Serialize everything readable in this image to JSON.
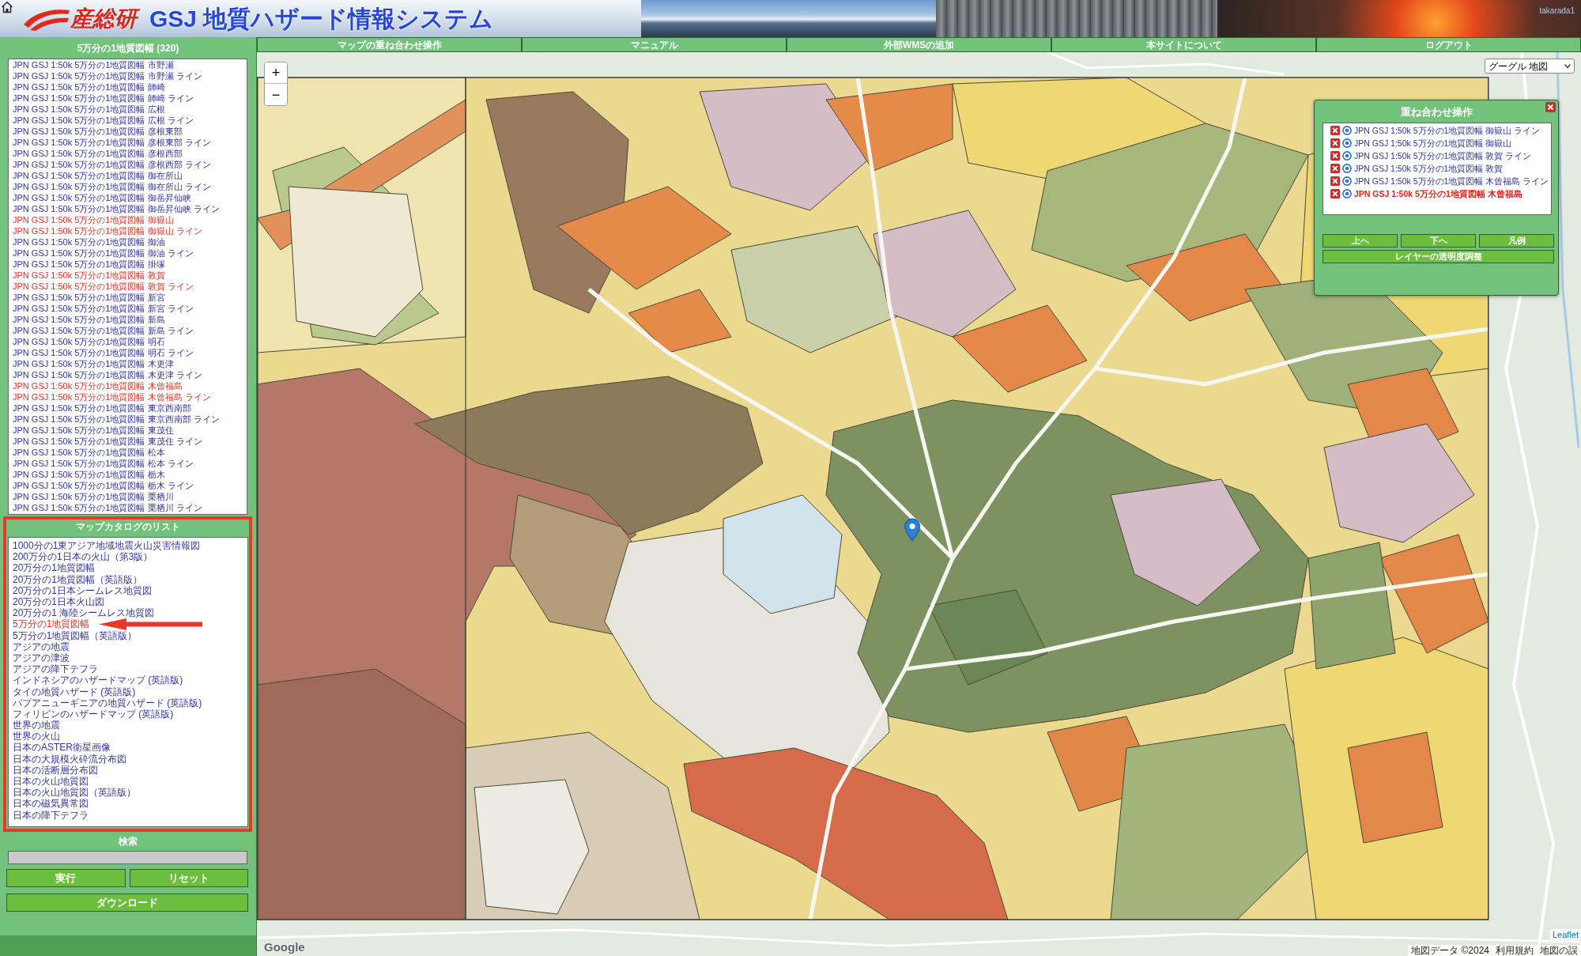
{
  "header": {
    "logo_text": "産総研",
    "title": "GSJ 地質ハザード情報システム",
    "user": "takarada1"
  },
  "nav": [
    {
      "label": "マップの重ね合わせ操作"
    },
    {
      "label": "マニュアル"
    },
    {
      "label": "外部WMSの追加"
    },
    {
      "label": "本サイトについて"
    },
    {
      "label": "ログアウト"
    }
  ],
  "sidebar": {
    "layer_list": {
      "title": "5万分の1地質図幅 (320)",
      "items": [
        {
          "label": "JPN GSJ 1:50k 5万分の1地質図幅 市野瀬",
          "selected": false
        },
        {
          "label": "JPN GSJ 1:50k 5万分の1地質図幅 市野瀬 ライン",
          "selected": false
        },
        {
          "label": "JPN GSJ 1:50k 5万分の1地質図幅 師崎",
          "selected": false
        },
        {
          "label": "JPN GSJ 1:50k 5万分の1地質図幅 師崎 ライン",
          "selected": false
        },
        {
          "label": "JPN GSJ 1:50k 5万分の1地質図幅 広根",
          "selected": false
        },
        {
          "label": "JPN GSJ 1:50k 5万分の1地質図幅 広根 ライン",
          "selected": false
        },
        {
          "label": "JPN GSJ 1:50k 5万分の1地質図幅 彦根東部",
          "selected": false
        },
        {
          "label": "JPN GSJ 1:50k 5万分の1地質図幅 彦根東部 ライン",
          "selected": false
        },
        {
          "label": "JPN GSJ 1:50k 5万分の1地質図幅 彦根西部",
          "selected": false
        },
        {
          "label": "JPN GSJ 1:50k 5万分の1地質図幅 彦根西部 ライン",
          "selected": false
        },
        {
          "label": "JPN GSJ 1:50k 5万分の1地質図幅 御在所山",
          "selected": false
        },
        {
          "label": "JPN GSJ 1:50k 5万分の1地質図幅 御在所山 ライン",
          "selected": false
        },
        {
          "label": "JPN GSJ 1:50k 5万分の1地質図幅 御岳昇仙峡",
          "selected": false
        },
        {
          "label": "JPN GSJ 1:50k 5万分の1地質図幅 御岳昇仙峡 ライン",
          "selected": false
        },
        {
          "label": "JPN GSJ 1:50k 5万分の1地質図幅 御嶽山",
          "selected": true
        },
        {
          "label": "JPN GSJ 1:50k 5万分の1地質図幅 御嶽山 ライン",
          "selected": true
        },
        {
          "label": "JPN GSJ 1:50k 5万分の1地質図幅 御油",
          "selected": false
        },
        {
          "label": "JPN GSJ 1:50k 5万分の1地質図幅 御油 ライン",
          "selected": false
        },
        {
          "label": "JPN GSJ 1:50k 5万分の1地質図幅 掛塚",
          "selected": false
        },
        {
          "label": "JPN GSJ 1:50k 5万分の1地質図幅 敦賀",
          "selected": true
        },
        {
          "label": "JPN GSJ 1:50k 5万分の1地質図幅 敦賀 ライン",
          "selected": true
        },
        {
          "label": "JPN GSJ 1:50k 5万分の1地質図幅 新宮",
          "selected": false
        },
        {
          "label": "JPN GSJ 1:50k 5万分の1地質図幅 新宮 ライン",
          "selected": false
        },
        {
          "label": "JPN GSJ 1:50k 5万分の1地質図幅 新島",
          "selected": false
        },
        {
          "label": "JPN GSJ 1:50k 5万分の1地質図幅 新島 ライン",
          "selected": false
        },
        {
          "label": "JPN GSJ 1:50k 5万分の1地質図幅 明石",
          "selected": false
        },
        {
          "label": "JPN GSJ 1:50k 5万分の1地質図幅 明石 ライン",
          "selected": false
        },
        {
          "label": "JPN GSJ 1:50k 5万分の1地質図幅 木更津",
          "selected": false
        },
        {
          "label": "JPN GSJ 1:50k 5万分の1地質図幅 木更津 ライン",
          "selected": false
        },
        {
          "label": "JPN GSJ 1:50k 5万分の1地質図幅 木曾福島",
          "selected": true
        },
        {
          "label": "JPN GSJ 1:50k 5万分の1地質図幅 木曾福島 ライン",
          "selected": true
        },
        {
          "label": "JPN GSJ 1:50k 5万分の1地質図幅 東京西南部",
          "selected": false
        },
        {
          "label": "JPN GSJ 1:50k 5万分の1地質図幅 東京西南部 ライン",
          "selected": false
        },
        {
          "label": "JPN GSJ 1:50k 5万分の1地質図幅 東茂住",
          "selected": false
        },
        {
          "label": "JPN GSJ 1:50k 5万分の1地質図幅 東茂住 ライン",
          "selected": false
        },
        {
          "label": "JPN GSJ 1:50k 5万分の1地質図幅 松本",
          "selected": false
        },
        {
          "label": "JPN GSJ 1:50k 5万分の1地質図幅 松本 ライン",
          "selected": false
        },
        {
          "label": "JPN GSJ 1:50k 5万分の1地質図幅 栃木",
          "selected": false
        },
        {
          "label": "JPN GSJ 1:50k 5万分の1地質図幅 栃木 ライン",
          "selected": false
        },
        {
          "label": "JPN GSJ 1:50k 5万分の1地質図幅 栗栖川",
          "selected": false
        },
        {
          "label": "JPN GSJ 1:50k 5万分の1地質図幅 栗栖川 ライン",
          "selected": false
        }
      ]
    },
    "catalog": {
      "title": "マップカタログのリスト",
      "items": [
        {
          "label": "1000分の1東アジア地域地震火山災害情報図",
          "selected": false
        },
        {
          "label": "200万分の1日本の火山（第3版）",
          "selected": false
        },
        {
          "label": "20万分の1地質図幅",
          "selected": false
        },
        {
          "label": "20万分の1地質図幅（英語版）",
          "selected": false
        },
        {
          "label": "20万分の1日本シームレス地質図",
          "selected": false
        },
        {
          "label": "20万分の1日本火山図",
          "selected": false
        },
        {
          "label": "20万分の1 海陸シームレス地質図",
          "selected": false
        },
        {
          "label": "5万分の1地質図幅",
          "selected": true
        },
        {
          "label": "5万分の1地質図幅（英語版）",
          "selected": false
        },
        {
          "label": "アジアの地震",
          "selected": false
        },
        {
          "label": "アジアの津波",
          "selected": false
        },
        {
          "label": "アジアの降下テフラ",
          "selected": false
        },
        {
          "label": "インドネシアのハザードマップ (英語版)",
          "selected": false
        },
        {
          "label": "タイの地質ハザード (英語版)",
          "selected": false
        },
        {
          "label": "パプアニューギニアの地質ハザード (英語版)",
          "selected": false
        },
        {
          "label": "フィリピンのハザードマップ (英語版)",
          "selected": false
        },
        {
          "label": "世界の地震",
          "selected": false
        },
        {
          "label": "世界の火山",
          "selected": false
        },
        {
          "label": "日本のASTER衛星画像",
          "selected": false
        },
        {
          "label": "日本の大規模火砕流分布図",
          "selected": false
        },
        {
          "label": "日本の活断層分布図",
          "selected": false
        },
        {
          "label": "日本の火山地質図",
          "selected": false
        },
        {
          "label": "日本の火山地質図（英語版）",
          "selected": false
        },
        {
          "label": "日本の磁気異常図",
          "selected": false
        },
        {
          "label": "日本の降下テフラ",
          "selected": false
        }
      ]
    },
    "search": {
      "title": "検索"
    },
    "buttons": [
      {
        "label": "実行"
      },
      {
        "label": "リセット"
      }
    ],
    "download_button": {
      "label": "ダウンロード"
    }
  },
  "map": {
    "zoom_in": "+",
    "zoom_out": "−",
    "map_type": "グーグル 地図",
    "google_logo": "Google",
    "leaflet": "Leaflet",
    "attribution": [
      "地図データ ©2024",
      "利用規約",
      "地図の誤"
    ]
  },
  "overlay_panel": {
    "title": "重ね合わせ操作",
    "layers": [
      {
        "label": "JPN GSJ 1:50k 5万分の1地質図幅 御嶽山 ライン",
        "selected": false
      },
      {
        "label": "JPN GSJ 1:50k 5万分の1地質図幅 御嶽山",
        "selected": false
      },
      {
        "label": "JPN GSJ 1:50k 5万分の1地質図幅 敦賀 ライン",
        "selected": false
      },
      {
        "label": "JPN GSJ 1:50k 5万分の1地質図幅 敦賀",
        "selected": false
      },
      {
        "label": "JPN GSJ 1:50k 5万分の1地質図幅 木曾福島 ライン",
        "selected": false
      },
      {
        "label": "JPN GSJ 1:50k 5万分の1地質図幅 木曾福島",
        "selected": true
      }
    ],
    "buttons": [
      {
        "label": "上へ"
      },
      {
        "label": "下へ"
      },
      {
        "label": "凡例"
      }
    ],
    "opacity_button": {
      "label": "レイヤーの透明度調整"
    }
  }
}
